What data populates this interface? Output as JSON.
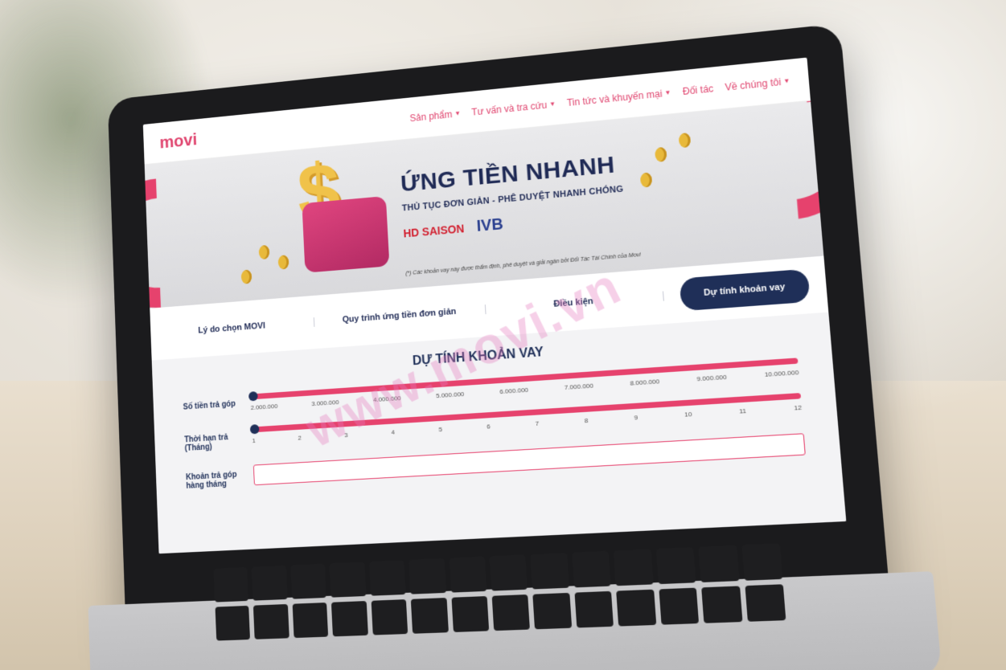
{
  "site": {
    "logo": "movi"
  },
  "nav": [
    {
      "label": "Sản phẩm",
      "has_caret": true
    },
    {
      "label": "Tư vấn và tra cứu",
      "has_caret": true
    },
    {
      "label": "Tin tức và khuyến mại",
      "has_caret": true
    },
    {
      "label": "Đối tác",
      "has_caret": false
    },
    {
      "label": "Về chúng tôi",
      "has_caret": true
    }
  ],
  "banner": {
    "headline": "ỨNG TIỀN NHANH",
    "subline": "THỦ TỤC ĐƠN GIẢN - PHÊ DUYỆT NHANH CHÓNG",
    "partner_1": "HD SAISON",
    "partner_2": "IVB",
    "disclaimer": "(*) Các khoản vay này được thẩm định, phê duyệt và giải ngân bởi Đối Tác Tài Chính của Movi"
  },
  "tabs": [
    "Lý do chọn MOVI",
    "Quy trình ứng tiền đơn giản",
    "Điều kiện"
  ],
  "cta_label": "Dự tính khoản vay",
  "calculator": {
    "title": "DỰ TÍNH KHOẢN VAY",
    "amount_label": "Số tiền trả góp",
    "amount_ticks": [
      "2.000.000",
      "3.000.000",
      "4.000.000",
      "5.000.000",
      "6.000.000",
      "7.000.000",
      "8.000.000",
      "9.000.000",
      "10.000.000"
    ],
    "amount_value_fraction": 0,
    "term_label": "Thời hạn trả (Tháng)",
    "term_ticks": [
      "1",
      "2",
      "3",
      "4",
      "5",
      "6",
      "7",
      "8",
      "9",
      "10",
      "11",
      "12"
    ],
    "term_value_fraction": 0,
    "monthly_label": "Khoản trả góp hàng tháng"
  },
  "watermark": "www.movi.vn",
  "colors": {
    "brand_pink": "#e6426d",
    "navy": "#1f2f58"
  }
}
